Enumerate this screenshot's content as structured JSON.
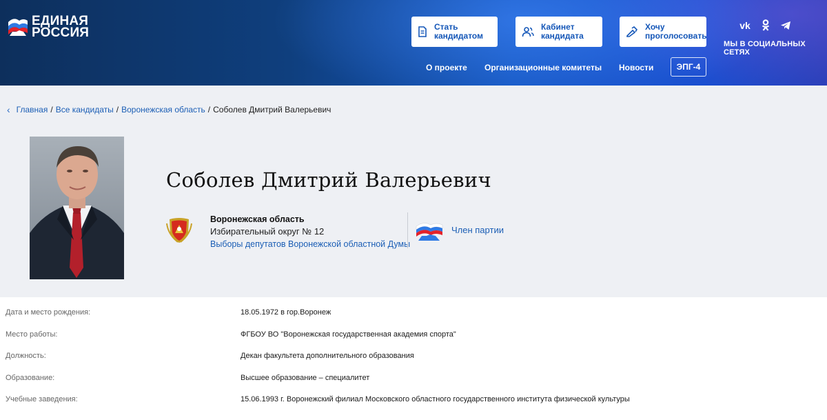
{
  "header": {
    "logo": {
      "line1": "ЕДИНАЯ",
      "line2": "РОССИЯ"
    },
    "buttons": {
      "become_candidate": "Стать кандидатом",
      "candidate_cabinet": "Кабинет кандидата",
      "want_to_vote": "Хочу проголосовать"
    },
    "social": {
      "items": [
        "vk",
        "ok",
        "telegram"
      ],
      "label": "МЫ В СОЦИАЛЬНЫХ СЕТЯХ"
    },
    "nav": {
      "about": "О проекте",
      "org_committees": "Организационные комитеты",
      "news": "Новости",
      "epg": "ЭПГ-4"
    }
  },
  "breadcrumbs": {
    "home": "Главная",
    "all_candidates": "Все кандидаты",
    "region": "Воронежская область",
    "current": "Соболев Дмитрий Валерьевич"
  },
  "candidate": {
    "name": "Соболев Дмитрий Валерьевич",
    "region": "Воронежская область",
    "district": "Избирательный округ № 12",
    "election": "Выборы депутатов Воронежской областной Думы",
    "party_status": "Член партии"
  },
  "details": [
    {
      "label": "Дата и место рождения:",
      "value": "18.05.1972 в гор.Воронеж"
    },
    {
      "label": "Место работы:",
      "value": "ФГБОУ ВО \"Воронежская государственная академия спорта\""
    },
    {
      "label": "Должность:",
      "value": "Декан факультета дополнительного образования"
    },
    {
      "label": "Образование:",
      "value": "Высшее образование – специалитет"
    },
    {
      "label": "Учебные заведения:",
      "value": "15.06.1993 г. Воронежский филиал Московского областного государственного института физической культуры"
    }
  ],
  "colors": {
    "brand_blue": "#1557b8",
    "link_blue": "#1b5eb5",
    "header_dark": "#0d2f5c",
    "profile_bg": "#eef0f4"
  }
}
